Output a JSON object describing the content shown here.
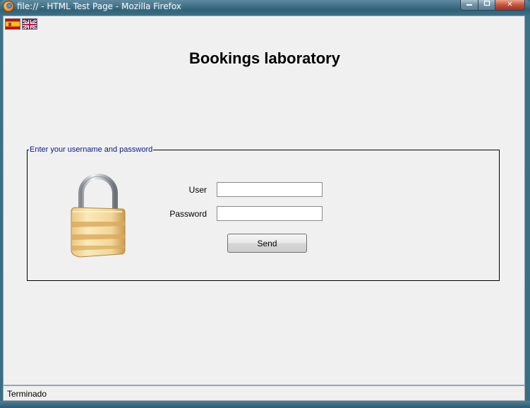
{
  "window": {
    "title": "file:// - HTML Test Page - Mozilla Firefox",
    "controls": {
      "minimize": "",
      "maximize": "",
      "close": "✕"
    }
  },
  "languages": [
    {
      "name": "Spanish",
      "icon": "spain-flag-icon"
    },
    {
      "name": "English",
      "icon": "uk-flag-icon"
    }
  ],
  "page": {
    "title": "Bookings laboratory"
  },
  "login": {
    "legend": "Enter your username and password",
    "icon": "padlock-icon",
    "user_label": "User",
    "user_value": "",
    "password_label": "Password",
    "password_value": "",
    "send_label": "Send"
  },
  "status": {
    "text": "Terminado"
  },
  "colors": {
    "legend": "#0a1a8c",
    "content_bg": "#f0f0f0",
    "titlebar": "#2f6076"
  }
}
